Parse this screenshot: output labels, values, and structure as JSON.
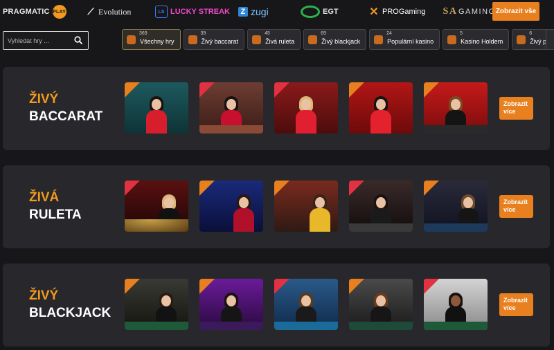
{
  "providers": [
    {
      "name": "PRAGMATIC",
      "mark": "PLAY"
    },
    {
      "name": "Evolution",
      "mark": "⟋"
    },
    {
      "name": "LUCKY STREAK",
      "mark": "LS"
    },
    {
      "name": "zugi",
      "mark": "Z"
    },
    {
      "name": "EGT",
      "mark": ""
    },
    {
      "name": "PROGaming",
      "mark": "✕"
    },
    {
      "name": "GAMING",
      "mark": "SA"
    }
  ],
  "top_show_all": "Zobrazit vše",
  "search": {
    "placeholder": "Vyhledat hry ..."
  },
  "categories": [
    {
      "count": "369",
      "label": "Všechny hry",
      "icon": "all-games-icon"
    },
    {
      "count": "39",
      "label": "Živý baccarat",
      "icon": "cards-icon"
    },
    {
      "count": "45",
      "label": "Živá ruleta",
      "icon": "roulette-icon"
    },
    {
      "count": "69",
      "label": "Živý blackjack",
      "icon": "blackjack-icon"
    },
    {
      "count": "24",
      "label": "Populární kasino",
      "icon": "diamond-icon"
    },
    {
      "count": "5",
      "label": "Kasino Holdem",
      "icon": "holdem-icon"
    },
    {
      "count": "6",
      "label": "Živý poker",
      "icon": "poker-icon"
    }
  ],
  "sections": [
    {
      "title_line1": "ŽIVÝ",
      "title_line2": "BACCARAT",
      "more": "Zobrazit více"
    },
    {
      "title_line1": "ŽIVÁ",
      "title_line2": "RULETA",
      "more": "Zobrazit více"
    },
    {
      "title_line1": "ŽIVÝ",
      "title_line2": "BLACKJACK",
      "more": "Zobrazit více"
    }
  ],
  "colors": {
    "accent": "#e8801f",
    "title_orange": "#f29a1f",
    "panel": "#28282c",
    "background": "#17171a"
  }
}
